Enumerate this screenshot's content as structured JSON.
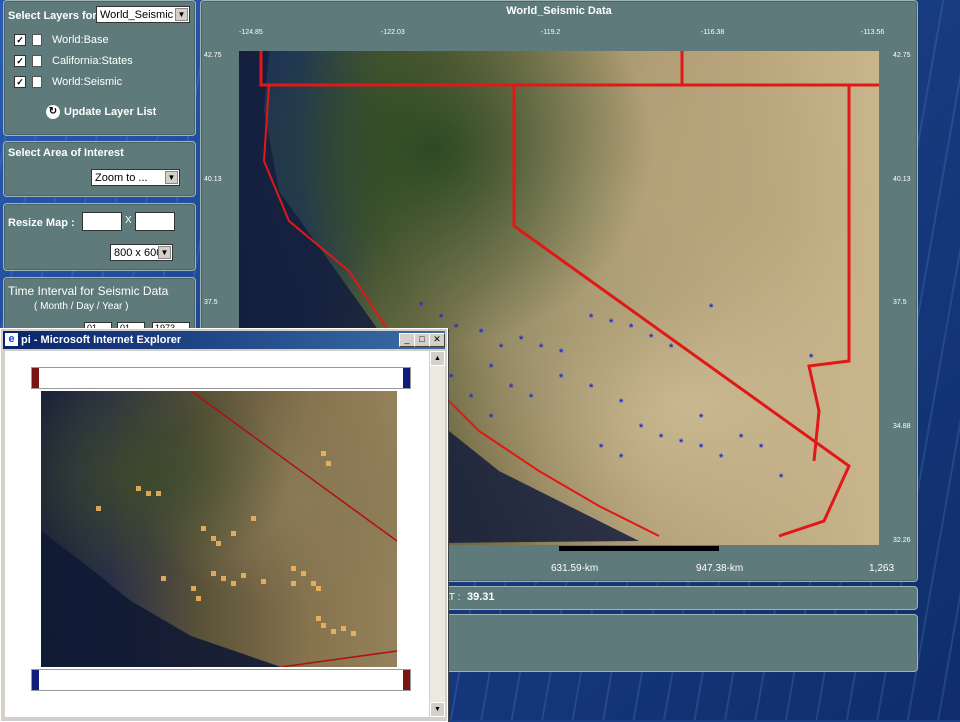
{
  "layers_panel": {
    "title": "Select Layers for",
    "service": "World_Seismic",
    "layers": [
      "World:Base",
      "California:States",
      "World:Seismic"
    ],
    "update_label": "Update Layer List"
  },
  "area_panel": {
    "title": "Select Area of Interest",
    "zoom_value": "Zoom to ..."
  },
  "resize_panel": {
    "label": "Resize Map :",
    "x_sep": "X",
    "size_value": "800 x 600"
  },
  "time_panel": {
    "title": "Time Interval for Seismic Data",
    "subtitle": "( Month / Day / Year )",
    "v1": "01",
    "v2": "01",
    "v3": "1973"
  },
  "map": {
    "title": "World_Seismic Data",
    "lon_ticks": [
      "-124.85",
      "-122.03",
      "-119.2",
      "-116.38",
      "-113.56"
    ],
    "lat_ticks": [
      "42.75",
      "40.13",
      "37.5",
      "34.88",
      "32.26"
    ],
    "scale_labels": [
      "631.59-km",
      "947.38-km",
      "1,263"
    ],
    "coord_prefix": "AT :",
    "coord_value": "39.31"
  },
  "ie_window": {
    "title": "pi - Microsoft Internet Explorer"
  },
  "colors": {
    "panel": "#5e7a7a",
    "quake_marker": "#2230d0",
    "heat_marker": "#f4b860",
    "boundary": "#e01818"
  }
}
